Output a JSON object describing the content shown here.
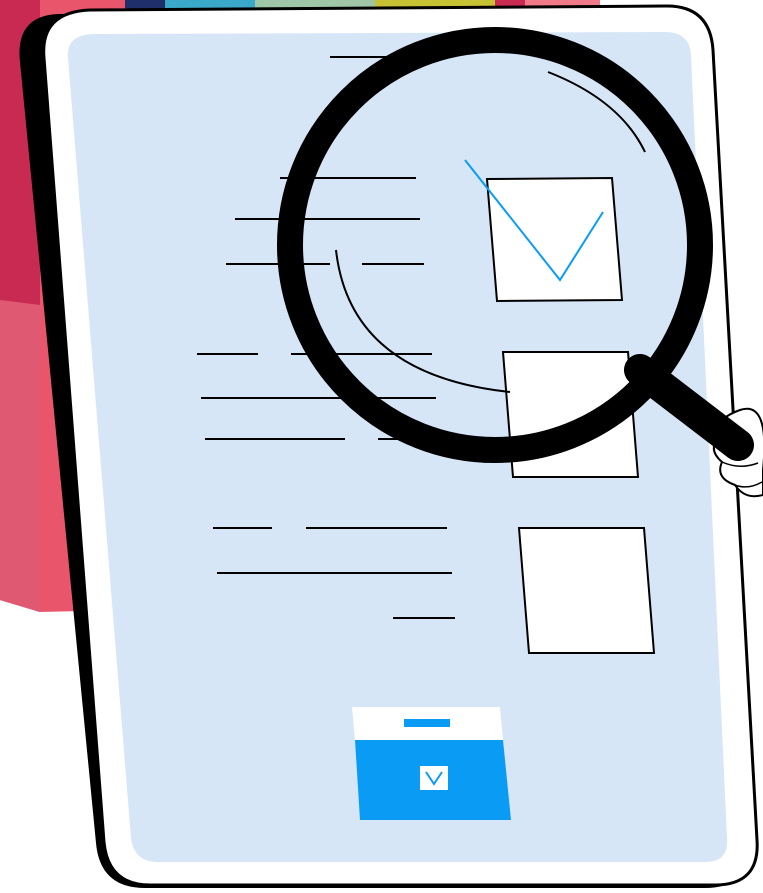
{
  "illustration": {
    "subject": "tablet-checklist-under-magnifying-glass",
    "colors": {
      "screen_fill": "#d6e6f7",
      "accent_blue": "#0a9cf5",
      "outline": "#000000",
      "paper": "#ffffff",
      "binder_red": "#e9566c",
      "binder_dark": "#b01945"
    },
    "icons": [
      "checkbox-checked-icon",
      "checkbox-empty-icon",
      "magnifying-glass-icon",
      "hand-icon",
      "folder-icon",
      "checkmark-icon"
    ],
    "checklist": {
      "items": [
        {
          "state": "checked"
        },
        {
          "state": "unchecked"
        },
        {
          "state": "unchecked"
        }
      ]
    }
  }
}
